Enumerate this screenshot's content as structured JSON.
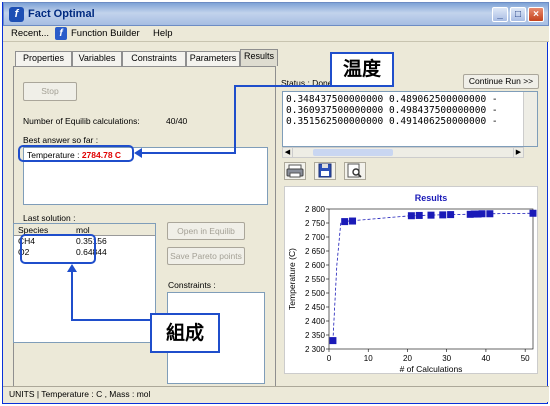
{
  "window": {
    "title": "Fact Optimal",
    "min": "_",
    "max": "□",
    "close": "×"
  },
  "menu": {
    "recent": "Recent...",
    "function_builder": "Function Builder",
    "help": "Help"
  },
  "tabs": [
    "Properties",
    "Variables",
    "Constraints",
    "Parameters",
    "Results"
  ],
  "left": {
    "stop_label": "Stop",
    "equilib_label": "Number of Equilib calculations:",
    "equilib_value": "40/40",
    "best_label": "Best answer so far :",
    "temp_label": "Temperature :",
    "temp_value": "2784.78 C",
    "last_solution_label": "Last solution :",
    "species_header": "Species",
    "mol_header": "mol",
    "species": [
      {
        "name": "CH4",
        "mol": "0.35156"
      },
      {
        "name": "O2",
        "mol": "0.64844"
      }
    ],
    "open_equilib": "Open in Equilib",
    "save_pareto": "Save Pareto points",
    "constraints_label": "Constraints :"
  },
  "right": {
    "status": "Status : Done",
    "continue": "Continue Run >>",
    "results_lines": [
      "0.348437500000000  0.489062500000000 -",
      "0.360937500000000  0.498437500000000 -",
      "0.351562500000000  0.491406250000000 -"
    ],
    "toolbar_icons": [
      "printer-icon",
      "save-icon",
      "zoom-icon"
    ]
  },
  "callouts": {
    "temperature": "温度",
    "composition": "組成"
  },
  "statusbar": "UNITS | Temperature : C , Mass : mol",
  "chart_data": {
    "type": "scatter",
    "title": "Results",
    "xlabel": "# of Calculations",
    "ylabel": "Temperature (C)",
    "xlim": [
      0,
      52
    ],
    "ylim": [
      2300,
      2800
    ],
    "xticks": [
      0,
      10,
      20,
      30,
      40,
      50
    ],
    "yticks": [
      2300,
      2350,
      2400,
      2450,
      2500,
      2550,
      2600,
      2650,
      2700,
      2750,
      2800
    ],
    "series": [
      {
        "x": [
          1,
          2,
          3,
          4,
          5,
          20,
          21,
          22,
          23,
          24,
          25,
          28,
          29,
          30,
          31,
          35,
          36,
          37,
          38,
          39,
          41,
          52
        ],
        "y": [
          2330,
          2600,
          2750,
          2755,
          2757,
          2775,
          2776,
          2776,
          2777,
          2777,
          2778,
          2779,
          2779,
          2780,
          2780,
          2781,
          2781,
          2782,
          2782,
          2783,
          2783,
          2784.78
        ],
        "color": "#1a1ab8"
      }
    ],
    "markers_x": [
      1,
      4,
      6,
      21,
      23,
      26,
      29,
      31,
      36,
      37,
      38,
      39,
      41,
      52
    ]
  }
}
